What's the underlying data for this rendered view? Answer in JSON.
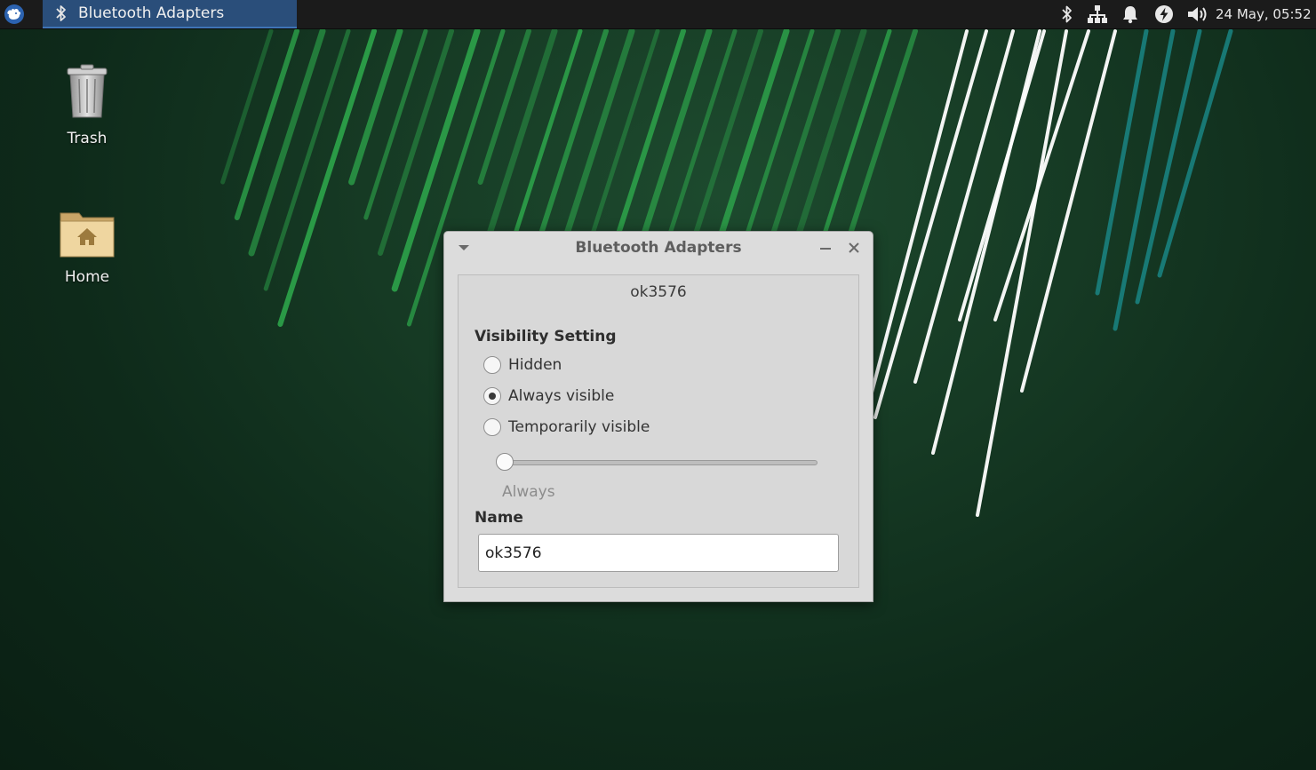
{
  "panel": {
    "task_button_label": "Bluetooth Adapters",
    "clock": "24 May, 05:52",
    "icons": [
      "xfce-menu-icon",
      "bluetooth-icon",
      "network-icon",
      "notifications-bell-icon",
      "power-icon",
      "volume-icon"
    ]
  },
  "desktop": {
    "icons": [
      {
        "label": "Trash",
        "icon": "trash-icon"
      },
      {
        "label": "Home",
        "icon": "home-folder-icon"
      }
    ]
  },
  "dialog": {
    "title": "Bluetooth Adapters",
    "adapter_name": "ok3576",
    "visibility": {
      "title": "Visibility Setting",
      "options": [
        {
          "label": "Hidden",
          "selected": false
        },
        {
          "label": "Always visible",
          "selected": true
        },
        {
          "label": "Temporarily visible",
          "selected": false
        }
      ],
      "timeout_slider": {
        "value_fraction": 0.0,
        "caption": "Always"
      }
    },
    "name_section": {
      "title": "Name",
      "value": "ok3576"
    }
  },
  "colors": {
    "wallpaper_dark": "#0e2a1a",
    "wallpaper_light": "#1d4a2e",
    "stripe_green": "#2fae4e",
    "stripe_white": "#ffffff",
    "stripe_teal": "#1a8a8a",
    "panel_bg": "#1b1b1b",
    "task_active": "#2a4e7a"
  }
}
